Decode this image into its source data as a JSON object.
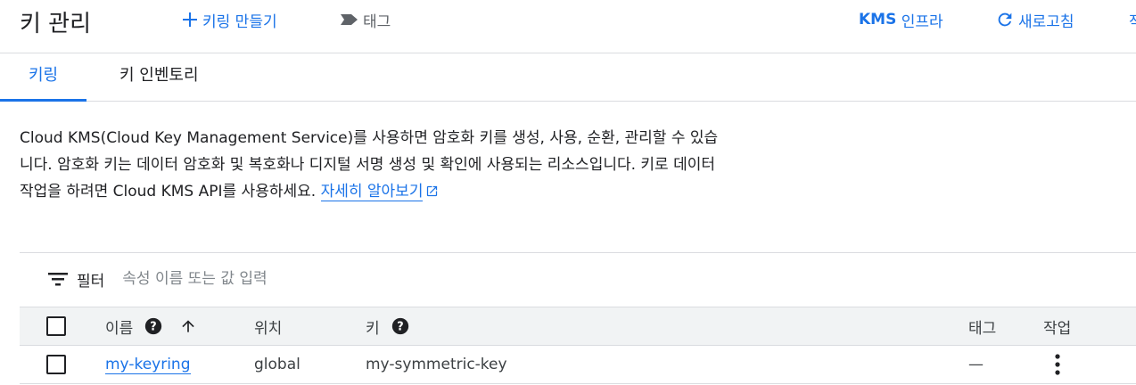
{
  "header": {
    "title": "키 관리",
    "create_label": "키링 만들기",
    "tags_label": "태그",
    "kms_bold": "KMS",
    "kms_rest": " 인프라",
    "refresh_label": "새로고침",
    "overflow_label": "작"
  },
  "tabs": [
    {
      "label": "키링",
      "active": true
    },
    {
      "label": "키 인벤토리",
      "active": false
    }
  ],
  "description": {
    "text": "Cloud KMS(Cloud Key Management Service)를 사용하면 암호화 키를 생성, 사용, 순환, 관리할 수 있습니다. 암호화 키는 데이터 암호화 및 복호화나 디지털 서명 생성 및 확인에 사용되는 리소스입니다. 키로 데이터 작업을 하려면 Cloud KMS API를 사용하세요.",
    "link_label": "자세히 알아보기"
  },
  "filter": {
    "label": "필터",
    "placeholder": "속성 이름 또는 값 입력"
  },
  "table": {
    "columns": {
      "name": "이름",
      "location": "위치",
      "key": "키",
      "tags": "태그",
      "actions": "작업"
    },
    "rows": [
      {
        "name": "my-keyring",
        "location": "global",
        "key": "my-symmetric-key",
        "tags": "—"
      }
    ]
  },
  "colors": {
    "accent": "#1a73e8",
    "text": "#202124",
    "muted": "#5f6368",
    "divider": "#dadce0",
    "header_bg": "#f1f3f4"
  }
}
